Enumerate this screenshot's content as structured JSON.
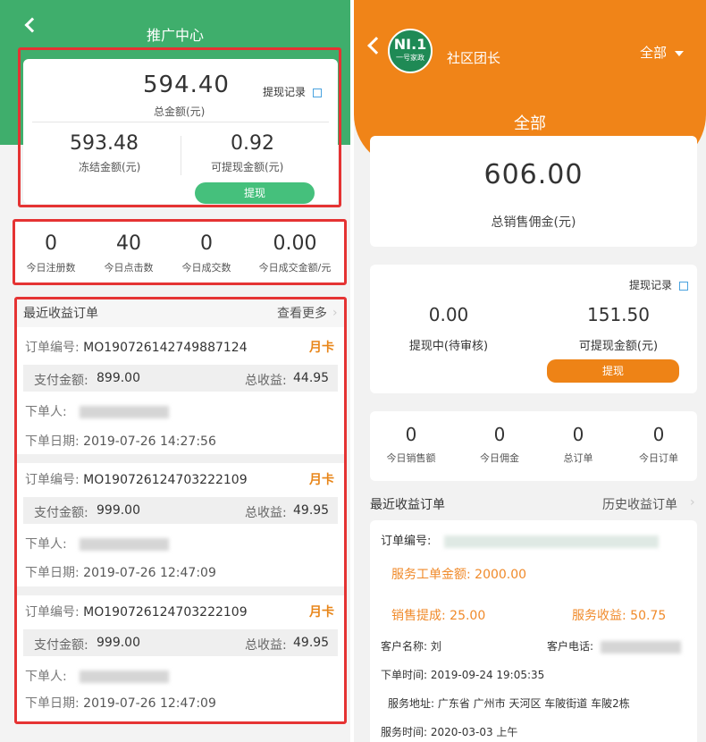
{
  "left": {
    "header": {
      "title": "推广中心"
    },
    "balance": {
      "total": "594.40",
      "total_label": "总金额(元)",
      "withdraw_record": "提现记录",
      "frozen": "593.48",
      "frozen_label": "冻结金额(元)",
      "available": "0.92",
      "available_label": "可提现金额(元)",
      "withdraw_btn": "提现"
    },
    "stats": [
      {
        "value": "0",
        "label": "今日注册数"
      },
      {
        "value": "40",
        "label": "今日点击数"
      },
      {
        "value": "0",
        "label": "今日成交数"
      },
      {
        "value": "0.00",
        "label": "今日成交金额/元"
      }
    ],
    "orders": {
      "title": "最近收益订单",
      "more": "查看更多",
      "items": [
        {
          "no_label": "订单编号:",
          "no": "MO190726142749887124",
          "tag": "月卡",
          "pay_label": "支付金额:",
          "pay": "899.00",
          "income_label": "总收益:",
          "income": "44.95",
          "buyer_label": "下单人:",
          "date_label": "下单日期:",
          "date": "2019-07-26 14:27:56"
        },
        {
          "no_label": "订单编号:",
          "no": "MO190726124703222109",
          "tag": "月卡",
          "pay_label": "支付金额:",
          "pay": "999.00",
          "income_label": "总收益:",
          "income": "49.95",
          "buyer_label": "下单人:",
          "date_label": "下单日期:",
          "date": "2019-07-26 12:47:09"
        },
        {
          "no_label": "订单编号:",
          "no": "MO190726124703222109",
          "tag": "月卡",
          "pay_label": "支付金额:",
          "pay": "999.00",
          "income_label": "总收益:",
          "income": "49.95",
          "buyer_label": "下单人:",
          "date_label": "下单日期:",
          "date": "2019-07-26 12:47:09"
        }
      ]
    }
  },
  "right": {
    "header": {
      "logo": "NI.1",
      "logo_sub": "一号家政",
      "title": "社区团长",
      "filter": "全部",
      "section": "全部"
    },
    "total": {
      "value": "606.00",
      "label": "总销售佣金(元)"
    },
    "withdraw": {
      "record": "提现记录",
      "pending": "0.00",
      "pending_label": "提现中(待审核)",
      "available": "151.50",
      "available_label": "可提现金额(元)",
      "btn": "提现"
    },
    "stats": [
      {
        "value": "0",
        "label": "今日销售额"
      },
      {
        "value": "0",
        "label": "今日佣金"
      },
      {
        "value": "0",
        "label": "总订单"
      },
      {
        "value": "0",
        "label": "今日订单"
      }
    ],
    "orders": {
      "title": "最近收益订单",
      "history": "历史收益订单",
      "no_label": "订单编号:",
      "service_amount": "服务工单金额: 2000.00",
      "commission": "销售提成: 25.00",
      "service_income": "服务收益: 50.75",
      "customer": "客户名称: 刘",
      "phone_label": "客户电话:",
      "order_time": "下单时间: 2019-09-24 19:05:35",
      "address": "服务地址: 广东省 广州市 天河区 车陂街道 车陂2栋",
      "service_time": "服务时间: 2020-03-03 上午"
    }
  },
  "colors": {
    "green": "#3fae6c",
    "orange": "#f08418",
    "highlight": "#e53333"
  }
}
